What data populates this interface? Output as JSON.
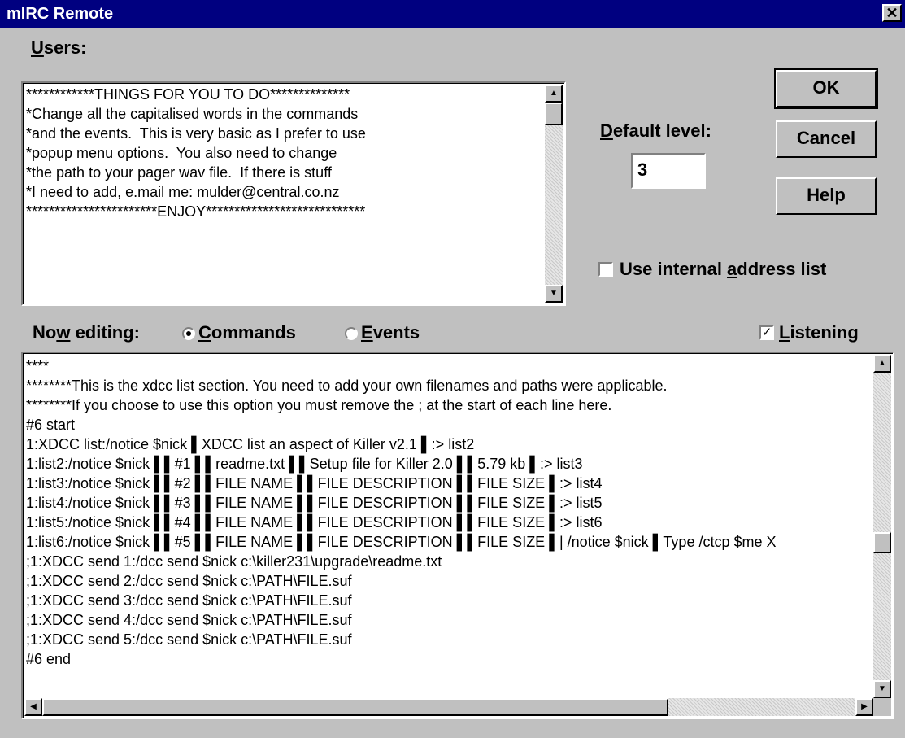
{
  "window": {
    "title": "mIRC Remote",
    "close_glyph": "✕"
  },
  "users": {
    "label_first": "U",
    "label_rest": "sers:",
    "lines": [
      "************THINGS FOR YOU TO DO**************",
      "*Change all the capitalised words in the commands",
      "*and the events.  This is very basic as I prefer to use",
      "*popup menu options.  You also need to change",
      "*the path to your pager wav file.  If there is stuff",
      "*I need to add, e.mail me: mulder@central.co.nz",
      "***********************ENJOY****************************"
    ]
  },
  "default_level": {
    "label_first": "D",
    "label_rest": "efault level:",
    "value": "3"
  },
  "buttons": {
    "ok": "OK",
    "cancel": "Cancel",
    "help": "Help"
  },
  "internal_address": {
    "label_a": "Use internal ",
    "label_u": "a",
    "label_b": "ddress list",
    "checked": false
  },
  "now_editing": {
    "label_a": "No",
    "label_u": "w",
    "label_b": " editing:",
    "commands_u": "C",
    "commands_rest": "ommands",
    "events_u": "E",
    "events_rest": "vents",
    "selected": "Commands"
  },
  "listening": {
    "label_u": "L",
    "label_rest": "istening",
    "checked": true,
    "check_glyph": "✓"
  },
  "editor": {
    "lines": [
      "****",
      "********This is the xdcc list section. You need to add your own filenames and paths were applicable.",
      "********If you choose to use this option you must remove the ; at the start of each line here.",
      "#6 start",
      "1:XDCC list:/notice $nick ▌XDCC list an aspect of Killer v2.1 ▌:> list2",
      "1:list2:/notice $nick ▌▌#1 ▌▌readme.txt ▌▌Setup file for Killer 2.0 ▌▌5.79 kb ▌:> list3",
      "1:list3:/notice $nick ▌▌#2 ▌▌FILE NAME ▌▌FILE DESCRIPTION ▌▌FILE SIZE ▌:> list4",
      "1:list4:/notice $nick ▌▌#3 ▌▌FILE NAME ▌▌FILE DESCRIPTION ▌▌FILE SIZE ▌:> list5",
      "1:list5:/notice $nick ▌▌#4 ▌▌FILE NAME ▌▌FILE DESCRIPTION ▌▌FILE SIZE ▌:> list6",
      "1:list6:/notice $nick ▌▌#5 ▌▌FILE NAME ▌▌FILE DESCRIPTION ▌▌FILE SIZE ▌| /notice $nick ▌Type /ctcp $me X",
      ";1:XDCC send 1:/dcc send $nick c:\\killer231\\upgrade\\readme.txt",
      ";1:XDCC send 2:/dcc send $nick c:\\PATH\\FILE.suf",
      ";1:XDCC send 3:/dcc send $nick c:\\PATH\\FILE.suf",
      ";1:XDCC send 4:/dcc send $nick c:\\PATH\\FILE.suf",
      ";1:XDCC send 5:/dcc send $nick c:\\PATH\\FILE.suf",
      "#6 end"
    ]
  },
  "scroll_glyphs": {
    "up": "▲",
    "down": "▼",
    "left": "◀",
    "right": "▶"
  }
}
